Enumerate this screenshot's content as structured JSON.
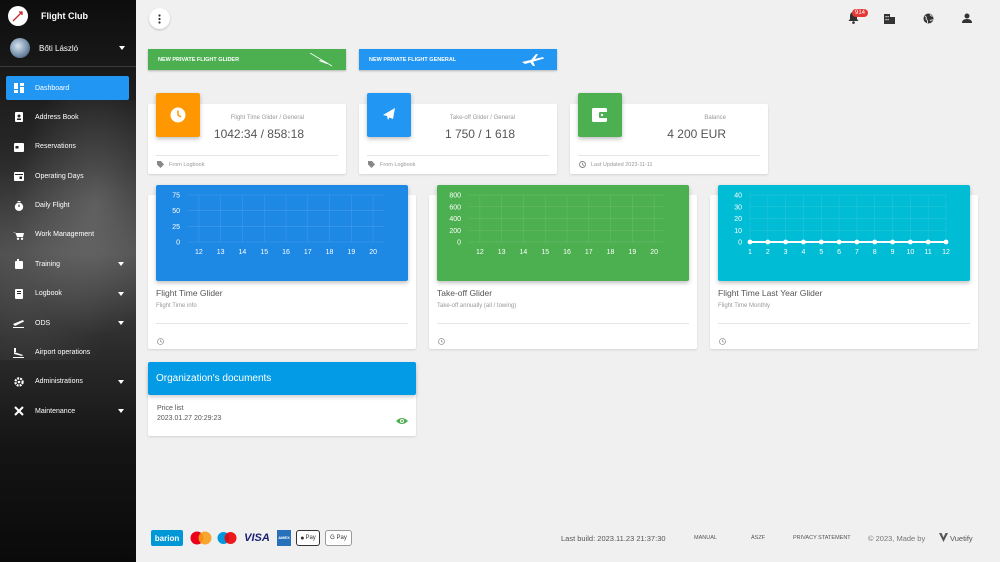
{
  "app": {
    "title": "Flight Club"
  },
  "user": {
    "name": "Bőti László"
  },
  "sidebar": {
    "items": [
      {
        "label": "Dashboard"
      },
      {
        "label": "Address Book"
      },
      {
        "label": "Reservations"
      },
      {
        "label": "Operating Days"
      },
      {
        "label": "Daily Flight"
      },
      {
        "label": "Work Management"
      },
      {
        "label": "Training"
      },
      {
        "label": "Logbook"
      },
      {
        "label": "ODS"
      },
      {
        "label": "Airport operations"
      },
      {
        "label": "Administrations"
      },
      {
        "label": "Maintenance"
      }
    ]
  },
  "topbar": {
    "notifications_count": "914"
  },
  "actions": {
    "glider_label": "NEW PRIVATE FLIGHT GLIDER",
    "general_label": "NEW PRIVATE FLIGHT GENERAL"
  },
  "stats": [
    {
      "label": "Flight Time Glider / General",
      "value": "1042:34 / 858:18",
      "footer": "From Logbook",
      "color": "#ff9800"
    },
    {
      "label": "Take-off Glider / General",
      "value": "1 750 / 1 618",
      "footer": "From Logbook",
      "color": "#2196f3"
    },
    {
      "label": "Balance",
      "value": "4 200 EUR",
      "footer": "Last Updated 2023-11-11",
      "color": "#4caf50"
    }
  ],
  "charts": [
    {
      "title": "Flight Time Glider",
      "subtitle": "Flight Time info",
      "color": "#1e88e5"
    },
    {
      "title": "Take-off Glider",
      "subtitle": "Take-off annually (all / towing)",
      "color": "#4caf50"
    },
    {
      "title": "Flight Time Last Year Glider",
      "subtitle": "Flight Time Monthly",
      "color": "#00bcd4"
    }
  ],
  "chart_data": [
    {
      "type": "bar",
      "categories": [
        "12",
        "13",
        "14",
        "15",
        "16",
        "17",
        "18",
        "19",
        "20"
      ],
      "values": [
        0,
        0,
        0,
        0,
        0,
        0,
        0,
        0,
        0
      ],
      "ylim": [
        0,
        75
      ],
      "yticks": [
        "0",
        "25",
        "50",
        "75"
      ]
    },
    {
      "type": "bar",
      "categories": [
        "12",
        "13",
        "14",
        "15",
        "16",
        "17",
        "18",
        "19",
        "20"
      ],
      "values": [
        0,
        0,
        0,
        0,
        0,
        0,
        0,
        0,
        0
      ],
      "ylim": [
        0,
        800
      ],
      "yticks": [
        "0",
        "200",
        "400",
        "600",
        "800"
      ]
    },
    {
      "type": "line",
      "x": [
        "1",
        "2",
        "3",
        "4",
        "5",
        "6",
        "7",
        "8",
        "9",
        "10",
        "11",
        "12"
      ],
      "values": [
        0,
        0,
        0,
        0,
        0,
        0,
        0,
        0,
        0,
        0,
        0,
        0
      ],
      "ylim": [
        0,
        40
      ],
      "yticks": [
        "0",
        "10",
        "20",
        "30",
        "40"
      ]
    }
  ],
  "documents": {
    "title": "Organization's documents",
    "items": [
      {
        "name": "Price list",
        "date": "2023.01.27 20:29:23"
      }
    ]
  },
  "footer": {
    "payments": [
      "barion",
      "VISA",
      "Pay",
      "G Pay"
    ],
    "amex": "AMEX",
    "build": "Last build: 2023.11.23 21:37:30",
    "manual": "MANUAL",
    "aszf": "ÁSZF",
    "privacy": "PRIVACY STATEMENT",
    "made": "© 2023, Made by",
    "vuetify": "Vuetify"
  }
}
